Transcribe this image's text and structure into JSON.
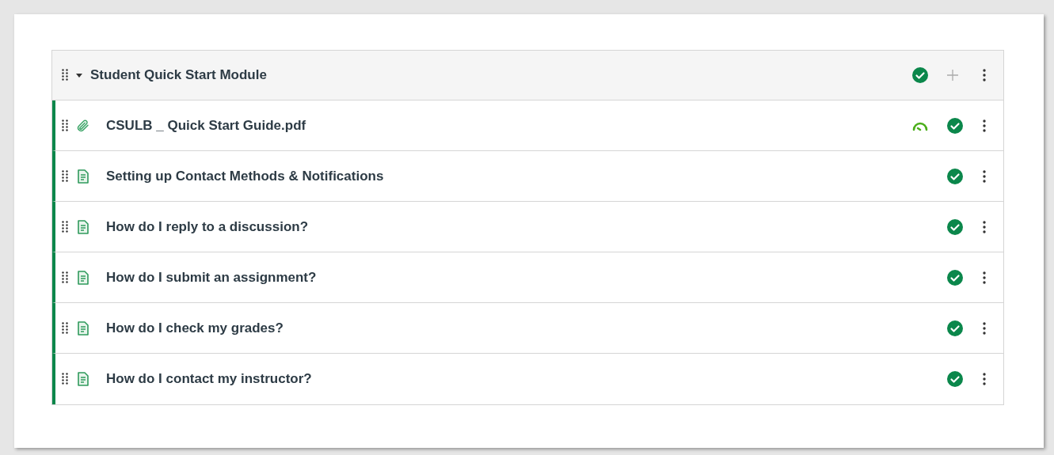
{
  "module": {
    "title": "Student Quick Start Module",
    "expanded": true,
    "published": true
  },
  "items": [
    {
      "kind": "file",
      "title": "CSULB _ Quick Start Guide.pdf",
      "mastery_paths": true,
      "published": true
    },
    {
      "kind": "page",
      "title": "Setting up Contact Methods & Notifications",
      "mastery_paths": false,
      "published": true
    },
    {
      "kind": "page",
      "title": "How do I reply to a discussion?",
      "mastery_paths": false,
      "published": true
    },
    {
      "kind": "page",
      "title": "How do I submit an assignment?",
      "mastery_paths": false,
      "published": true
    },
    {
      "kind": "page",
      "title": "How do I check my grades?",
      "mastery_paths": false,
      "published": true
    },
    {
      "kind": "page",
      "title": "How do I contact my instructor?",
      "mastery_paths": false,
      "published": true
    }
  ]
}
